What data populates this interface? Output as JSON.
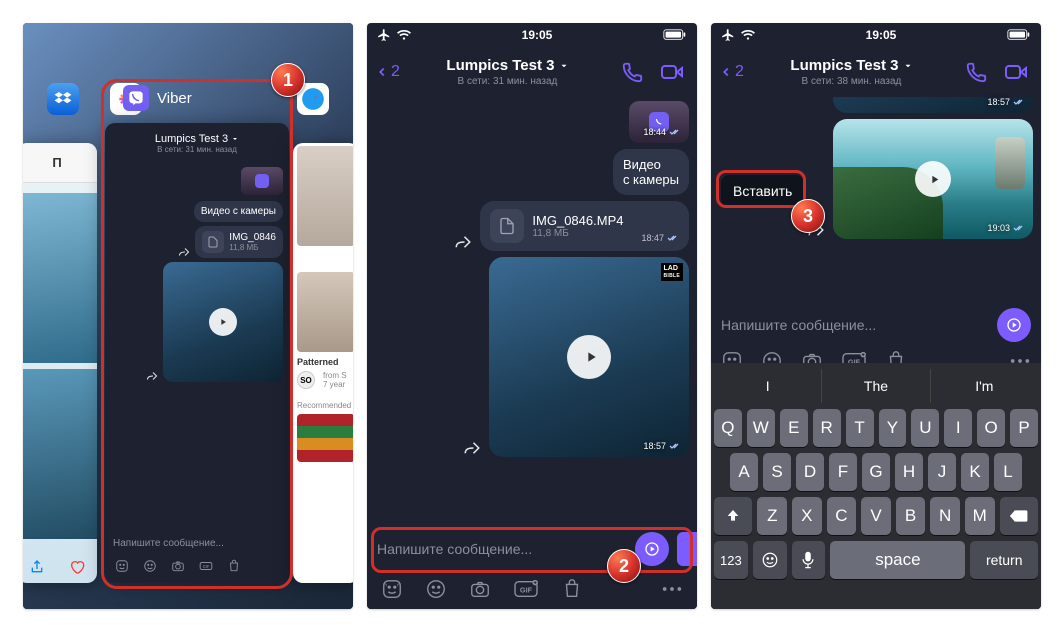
{
  "statusbar": {
    "time": "19:05",
    "time3": "19:05"
  },
  "app_switcher": {
    "app_name": "Viber",
    "mid": {
      "title": "Lumpics Test 3",
      "subtitle": "В сети: 31 мин. назад",
      "msg1": "Видео с камеры",
      "file_name": "IMG_0846",
      "file_size": "11,8 МБ",
      "placeholder": "Напишите сообщение..."
    },
    "right": {
      "title": "Patterned",
      "from": "from S",
      "age": "7 year",
      "rec": "Recommended"
    },
    "left": {
      "letter": "П"
    }
  },
  "chat2": {
    "title": "Lumpics Test 3",
    "subtitle": "В сети: 31 мин. назад",
    "back_count": "2",
    "msg_label": "Видео\nс камеры",
    "msg_ts": "18:44",
    "file_name": "IMG_0846.MP4",
    "file_size": "11,8 МБ",
    "file_ts": "18:47",
    "lad": "LAD",
    "bible": "BIBLE",
    "video_ts": "18:57",
    "placeholder": "Напишите сообщение..."
  },
  "chat3": {
    "title": "Lumpics Test 3",
    "subtitle": "В сети: 38 мин. назад",
    "back_count": "2",
    "prev_ts": "18:57",
    "video_ts": "19:03",
    "context_paste": "Вставить",
    "placeholder": "Напишите сообщение...",
    "suggestions": [
      "I",
      "The",
      "I'm"
    ],
    "rows": [
      [
        "Q",
        "W",
        "E",
        "R",
        "T",
        "Y",
        "U",
        "I",
        "O",
        "P"
      ],
      [
        "A",
        "S",
        "D",
        "F",
        "G",
        "H",
        "J",
        "K",
        "L"
      ],
      [
        "Z",
        "X",
        "C",
        "V",
        "B",
        "N",
        "M"
      ]
    ],
    "key_123": "123",
    "key_space": "space",
    "key_return": "return"
  },
  "badges": {
    "b1": "1",
    "b2": "2",
    "b3": "3"
  }
}
